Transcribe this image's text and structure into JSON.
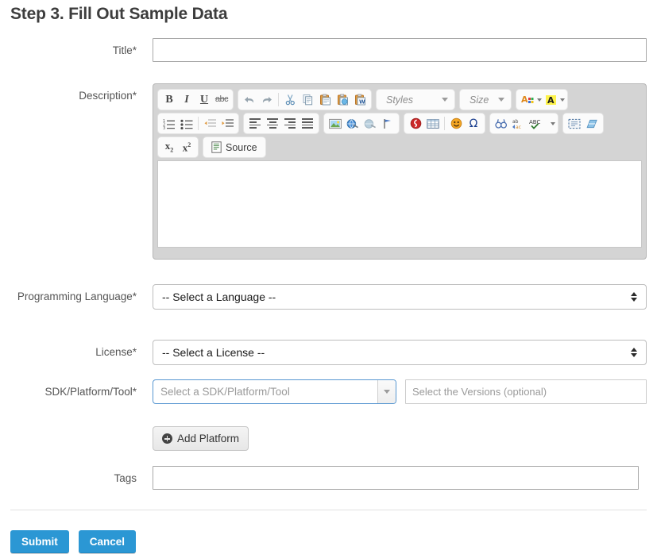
{
  "page": {
    "title": "Step 3. Fill Out Sample Data"
  },
  "form": {
    "title_field": {
      "label": "Title*",
      "value": "",
      "placeholder": ""
    },
    "description_field": {
      "label": "Description*",
      "value": ""
    },
    "programming_language_field": {
      "label": "Programming Language*",
      "selected": "-- Select a Language --"
    },
    "license_field": {
      "label": "License*",
      "selected": "-- Select a License --"
    },
    "sdk_field": {
      "label": "SDK/Platform/Tool*",
      "placeholder": "Select a SDK/Platform/Tool",
      "value": ""
    },
    "versions_field": {
      "placeholder": "Select the Versions (optional)",
      "value": ""
    },
    "add_platform_button": {
      "label": "Add Platform",
      "icon": "plus-circle-icon"
    },
    "tags_field": {
      "label": "Tags",
      "value": "",
      "placeholder": ""
    }
  },
  "editor": {
    "styles_dropdown": "Styles",
    "size_dropdown": "Size",
    "source_button": "Source",
    "toolbar_rows": [
      {
        "groups": [
          {
            "items": [
              "bold",
              "italic",
              "underline",
              "strikethrough"
            ]
          },
          {
            "items": [
              "undo",
              "redo",
              "separator",
              "cut",
              "copy",
              "paste",
              "paste-text",
              "paste-from-word"
            ]
          },
          {
            "items": [
              "styles-combo"
            ]
          },
          {
            "items": [
              "size-combo"
            ]
          },
          {
            "items": [
              "text-color",
              "background-color"
            ]
          }
        ]
      },
      {
        "groups": [
          {
            "items": [
              "numbered-list",
              "bulleted-list",
              "separator",
              "decrease-indent",
              "increase-indent"
            ]
          },
          {
            "items": [
              "align-left",
              "align-center",
              "align-right",
              "justify"
            ]
          },
          {
            "items": [
              "image",
              "link",
              "unlink",
              "anchor"
            ]
          },
          {
            "items": [
              "flash",
              "table",
              "separator",
              "smiley",
              "special-character"
            ]
          },
          {
            "items": [
              "find",
              "replace",
              "spell-check"
            ]
          },
          {
            "items": [
              "show-blocks",
              "remove-format"
            ]
          }
        ]
      },
      {
        "groups": [
          {
            "items": [
              "subscript",
              "superscript"
            ]
          },
          {
            "items": [
              "source"
            ]
          }
        ]
      }
    ],
    "glyphs": {
      "bold": "B",
      "italic": "I",
      "underline": "U",
      "strikethrough": "abc",
      "subscript": "x₂",
      "superscript": "x²",
      "undo": "↰",
      "redo": "↱",
      "omega": "Ω",
      "spell_abc": "ABC"
    }
  },
  "footer": {
    "submit_label": "Submit",
    "cancel_label": "Cancel"
  },
  "colors": {
    "primary_button": "#2b97d4",
    "primary_button_dark": "#2387c0",
    "heading_text": "#3d3d3d",
    "label_text": "#555555",
    "editor_chrome": "#d4d4d4",
    "select2_focus_border": "#5897d1",
    "input_border": "#a9a9a9",
    "divider": "#e2e2e2"
  }
}
